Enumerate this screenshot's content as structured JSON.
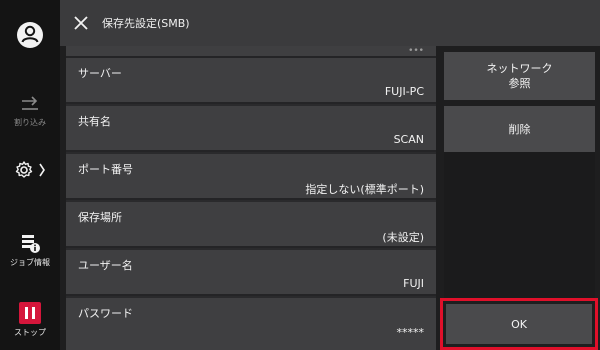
{
  "header": {
    "title": "保存先設定(SMB)"
  },
  "rail": {
    "interrupt_label": "割り込み",
    "job_info_label": "ジョブ情報",
    "stop_label": "ストップ"
  },
  "list": {
    "top_masked": "•••",
    "rows": [
      {
        "label": "サーバー",
        "value": "FUJI-PC"
      },
      {
        "label": "共有名",
        "value": "SCAN"
      },
      {
        "label": "ポート番号",
        "value": "指定しない(標準ポート)"
      },
      {
        "label": "保存場所",
        "value": "(未設定)"
      },
      {
        "label": "ユーザー名",
        "value": "FUJI"
      },
      {
        "label": "パスワード",
        "value": "*****"
      }
    ]
  },
  "side": {
    "network_line1": "ネットワーク",
    "network_line2": "参照",
    "delete_label": "削除",
    "ok_label": "OK"
  },
  "colors": {
    "highlight": "#e0102a",
    "stop": "#d5163b"
  }
}
